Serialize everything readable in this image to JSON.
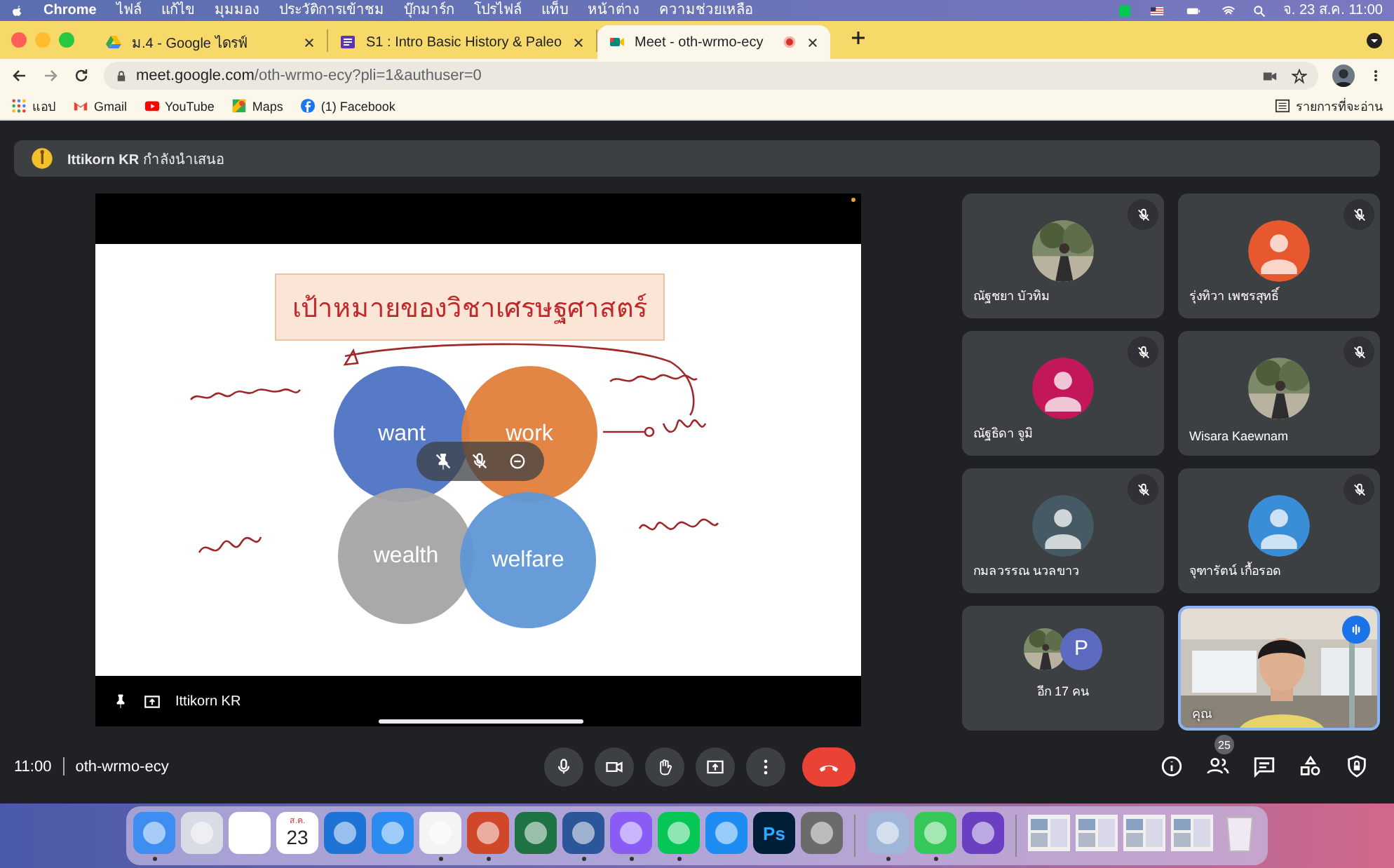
{
  "menu_bar": {
    "app": "Chrome",
    "items": [
      "ไฟล์",
      "แก้ไข",
      "มุมมอง",
      "ประวัติการเข้าชม",
      "บุ๊กมาร์ก",
      "โปรไฟล์",
      "แท็บ",
      "หน้าต่าง",
      "ความช่วยเหลือ"
    ],
    "clock": "จ. 23 ส.ค. 11:00"
  },
  "tabs": [
    {
      "title": "ม.4 - Google ไดรฟ์",
      "selected": false,
      "kind": "drive",
      "recording": false
    },
    {
      "title": "S1 : Intro Basic History & Paleo",
      "selected": false,
      "kind": "classroom",
      "recording": false
    },
    {
      "title": "Meet - oth-wrmo-ecy",
      "selected": true,
      "kind": "meet",
      "recording": true
    }
  ],
  "address_bar": {
    "host": "meet.google.com",
    "path": "/oth-wrmo-ecy?pli=1&authuser=0"
  },
  "bookmarks": [
    {
      "label": "แอป",
      "kind": "apps"
    },
    {
      "label": "Gmail",
      "kind": "mail"
    },
    {
      "label": "YouTube",
      "kind": "video"
    },
    {
      "label": "Maps",
      "kind": "map"
    },
    {
      "label": "(1) Facebook",
      "kind": "social"
    }
  ],
  "reading_list": "รายการที่จะอ่าน",
  "banner": "**Ittikorn KR** กำลังนำเสนอ",
  "presentation": {
    "slide_title": "เป้าหมายของวิชาเศรษฐศาสตร์",
    "circles": [
      {
        "label": "want",
        "color": "#4e73c4"
      },
      {
        "label": "work",
        "color": "#e27f3a"
      },
      {
        "label": "wealth",
        "color": "#a5a5a7"
      },
      {
        "label": "welfare",
        "color": "#5f97d6"
      }
    ],
    "presenter": "Ittikorn KR"
  },
  "participants": [
    {
      "name": "ณัฐชยา บัวทิม",
      "muted": true
    },
    {
      "name": "รุ่งทิวา เพชรสุทธิ์",
      "muted": true,
      "kind": "silhouette",
      "color": "#e8582e"
    },
    {
      "name": "ณัฐธิดา จูมิ",
      "muted": true,
      "kind": "silhouette",
      "color": "#c2185b"
    },
    {
      "name": "Wisara Kaewnam",
      "muted": true
    },
    {
      "name": "กมลวรรณ นวลขาว",
      "muted": true,
      "kind": "silhouette",
      "color": "#455a64"
    },
    {
      "name": "จุฑารัตน์ เกื้อรอด",
      "muted": true,
      "kind": "silhouette",
      "color": "#3a8ed8"
    }
  ],
  "others": {
    "label": "อีก 17 คน",
    "initial": "P"
  },
  "self": {
    "label": "คุณ",
    "speaking": true
  },
  "meeting_bar": {
    "time": "11:00",
    "code": "oth-wrmo-ecy",
    "people_count": "25"
  },
  "dock": [
    {
      "kind": "app",
      "color": "#3d8ef0",
      "running": true
    },
    {
      "kind": "app",
      "color": "#d8dce4",
      "running": false
    },
    {
      "kind": "app",
      "color": "#ffffff",
      "running": false
    },
    {
      "kind": "calendar",
      "month": "ส.ค.",
      "day": "23",
      "running": false
    },
    {
      "kind": "app",
      "color": "#1d74d6",
      "running": false
    },
    {
      "kind": "app",
      "color": "#2a8cf0",
      "running": false
    },
    {
      "kind": "app",
      "color": "#f4f4f4",
      "running": true
    },
    {
      "kind": "app",
      "color": "#d0472a",
      "running": true
    },
    {
      "kind": "app",
      "color": "#1f7244",
      "running": false
    },
    {
      "kind": "app",
      "color": "#2b579a",
      "running": true
    },
    {
      "kind": "app",
      "color": "#8a5cf6",
      "running": true
    },
    {
      "kind": "app",
      "color": "#06c755",
      "running": true
    },
    {
      "kind": "app",
      "color": "#1c8cf2",
      "running": false
    },
    {
      "kind": "labeled",
      "label": "Ps",
      "color": "#001e36",
      "running": false
    },
    {
      "kind": "app",
      "color": "#6b6b6b",
      "running": false
    },
    {
      "kind": "separator"
    },
    {
      "kind": "app",
      "color": "#9fb6d8",
      "running": true
    },
    {
      "kind": "app",
      "color": "#36c759",
      "running": true
    },
    {
      "kind": "app",
      "color": "#6a3fc1",
      "running": false
    },
    {
      "kind": "separator"
    },
    {
      "kind": "window",
      "running": false
    },
    {
      "kind": "window",
      "running": false
    },
    {
      "kind": "window",
      "running": false
    },
    {
      "kind": "window",
      "running": false
    },
    {
      "kind": "trash",
      "running": false
    }
  ]
}
